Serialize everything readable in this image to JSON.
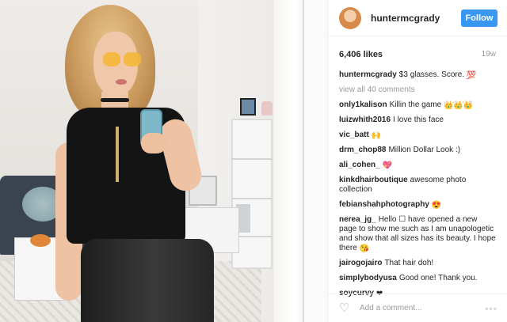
{
  "header": {
    "username": "huntermcgrady",
    "follow_label": "Follow"
  },
  "stats": {
    "likes": "6,406 likes",
    "age": "19w"
  },
  "caption": {
    "username": "huntermcgrady",
    "text": "$3 glasses. Score.",
    "emoji": "💯"
  },
  "view_all": "view all 40 comments",
  "comments": [
    {
      "username": "only1kalison",
      "text": "Killin the game",
      "emoji": "👑👑👑"
    },
    {
      "username": "luizwhith2016",
      "text": "I love this face",
      "emoji": ""
    },
    {
      "username": "vic_batt",
      "text": "",
      "emoji": "🙌"
    },
    {
      "username": "drm_chop88",
      "text": "Million Dollar Look :)",
      "emoji": ""
    },
    {
      "username": "ali_cohen_",
      "text": "",
      "emoji": "💖"
    },
    {
      "username": "kinkdhairboutique",
      "text": "awesome photo collection",
      "emoji": ""
    },
    {
      "username": "febianshahphotography",
      "text": "",
      "emoji": "😍"
    },
    {
      "username": "nerea_jg_",
      "text": "Hello ☐ have opened a new page to show me such as I am unapologetic and show that all sizes has its beauty. I hope there",
      "emoji": "😘"
    },
    {
      "username": "jairogojairo",
      "text": "That hair doh!",
      "emoji": ""
    },
    {
      "username": "simplybodyusa",
      "text": "Good one! Thank you.",
      "emoji": ""
    },
    {
      "username": "soycurvy",
      "text": "",
      "emoji": "❤"
    }
  ],
  "composer": {
    "placeholder": "Add a comment...",
    "heart_icon": "heart-outline-icon",
    "more_icon": "more-options-icon"
  },
  "colors": {
    "follow_button": "#3897f0",
    "muted_text": "#999999"
  }
}
